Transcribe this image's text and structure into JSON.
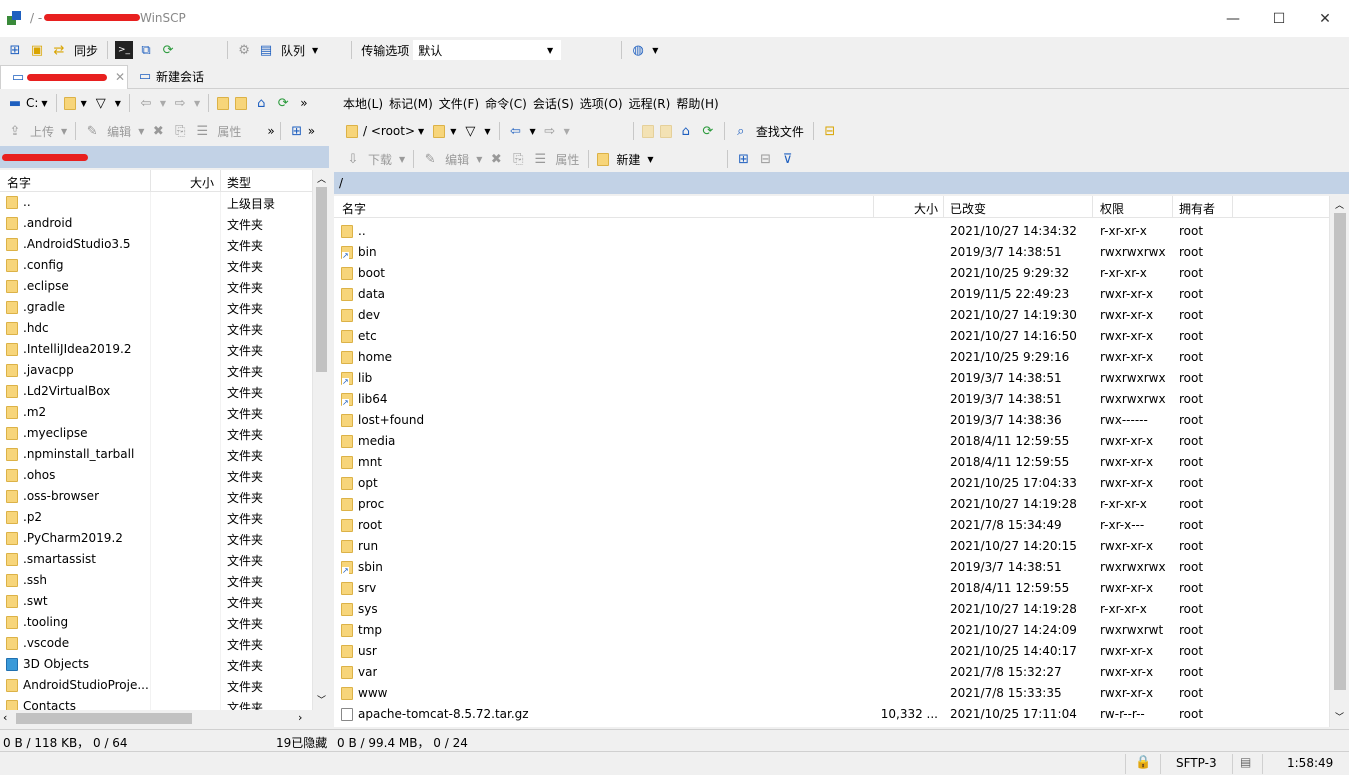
{
  "window": {
    "title": "/ - ▬▬▬▬ - WinSCP",
    "title_visible": "/ -",
    "title_suffix": "WinSCP",
    "minimize": "—",
    "maximize": "☐",
    "close": "✕"
  },
  "toolbar1": {
    "sync_label": "同步",
    "queue_label": "队列",
    "transfer_label": "传输选项",
    "transfer_value": "默认"
  },
  "tabs": {
    "session_tab": "▬▬▬▬",
    "new_session": "新建会话"
  },
  "menu": [
    "本地(L)",
    "标记(M)",
    "文件(F)",
    "命令(C)",
    "会话(S)",
    "选项(O)",
    "远程(R)",
    "帮助(H)"
  ],
  "local": {
    "drive": "C:",
    "upload": "上传",
    "edit": "编辑",
    "properties": "属性",
    "path": "▬▬▬▬",
    "columns": [
      "名字",
      "大小",
      "类型"
    ],
    "rows": [
      {
        "name": "..",
        "type": "上级目录",
        "icon": "up"
      },
      {
        "name": ".android",
        "type": "文件夹",
        "icon": "folder"
      },
      {
        "name": ".AndroidStudio3.5",
        "type": "文件夹",
        "icon": "folder"
      },
      {
        "name": ".config",
        "type": "文件夹",
        "icon": "folder"
      },
      {
        "name": ".eclipse",
        "type": "文件夹",
        "icon": "folder"
      },
      {
        "name": ".gradle",
        "type": "文件夹",
        "icon": "folder"
      },
      {
        "name": ".hdc",
        "type": "文件夹",
        "icon": "folder"
      },
      {
        "name": ".IntelliJIdea2019.2",
        "type": "文件夹",
        "icon": "folder"
      },
      {
        "name": ".javacpp",
        "type": "文件夹",
        "icon": "folder"
      },
      {
        "name": ".Ld2VirtualBox",
        "type": "文件夹",
        "icon": "folder"
      },
      {
        "name": ".m2",
        "type": "文件夹",
        "icon": "folder"
      },
      {
        "name": ".myeclipse",
        "type": "文件夹",
        "icon": "folder"
      },
      {
        "name": ".npminstall_tarball",
        "type": "文件夹",
        "icon": "folder"
      },
      {
        "name": ".ohos",
        "type": "文件夹",
        "icon": "folder"
      },
      {
        "name": ".oss-browser",
        "type": "文件夹",
        "icon": "folder"
      },
      {
        "name": ".p2",
        "type": "文件夹",
        "icon": "folder"
      },
      {
        "name": ".PyCharm2019.2",
        "type": "文件夹",
        "icon": "folder"
      },
      {
        "name": ".smartassist",
        "type": "文件夹",
        "icon": "folder"
      },
      {
        "name": ".ssh",
        "type": "文件夹",
        "icon": "folder"
      },
      {
        "name": ".swt",
        "type": "文件夹",
        "icon": "folder"
      },
      {
        "name": ".tooling",
        "type": "文件夹",
        "icon": "folder"
      },
      {
        "name": ".vscode",
        "type": "文件夹",
        "icon": "folder"
      },
      {
        "name": "3D Objects",
        "type": "文件夹",
        "icon": "obj"
      },
      {
        "name": "AndroidStudioProje...",
        "type": "文件夹",
        "icon": "folder"
      },
      {
        "name": "Contacts",
        "type": "文件夹",
        "icon": "folder"
      }
    ],
    "status_size": "0 B / 118 KB， 0 / 64",
    "status_hidden": "19已隐藏"
  },
  "remote": {
    "path_combo": "/ <root>",
    "find_files": "查找文件",
    "download": "下载",
    "edit": "编辑",
    "properties": "属性",
    "new": "新建",
    "path": "/",
    "columns": [
      "名字",
      "大小",
      "已改变",
      "权限",
      "拥有者"
    ],
    "rows": [
      {
        "name": "..",
        "size": "",
        "changed": "2021/10/27 14:34:32",
        "rights": "r-xr-xr-x",
        "owner": "root",
        "icon": "up"
      },
      {
        "name": "bin",
        "size": "",
        "changed": "2019/3/7 14:38:51",
        "rights": "rwxrwxrwx",
        "owner": "root",
        "icon": "link"
      },
      {
        "name": "boot",
        "size": "",
        "changed": "2021/10/25 9:29:32",
        "rights": "r-xr-xr-x",
        "owner": "root",
        "icon": "folder"
      },
      {
        "name": "data",
        "size": "",
        "changed": "2019/11/5 22:49:23",
        "rights": "rwxr-xr-x",
        "owner": "root",
        "icon": "folder"
      },
      {
        "name": "dev",
        "size": "",
        "changed": "2021/10/27 14:19:30",
        "rights": "rwxr-xr-x",
        "owner": "root",
        "icon": "folder"
      },
      {
        "name": "etc",
        "size": "",
        "changed": "2021/10/27 14:16:50",
        "rights": "rwxr-xr-x",
        "owner": "root",
        "icon": "folder"
      },
      {
        "name": "home",
        "size": "",
        "changed": "2021/10/25 9:29:16",
        "rights": "rwxr-xr-x",
        "owner": "root",
        "icon": "folder"
      },
      {
        "name": "lib",
        "size": "",
        "changed": "2019/3/7 14:38:51",
        "rights": "rwxrwxrwx",
        "owner": "root",
        "icon": "link"
      },
      {
        "name": "lib64",
        "size": "",
        "changed": "2019/3/7 14:38:51",
        "rights": "rwxrwxrwx",
        "owner": "root",
        "icon": "link"
      },
      {
        "name": "lost+found",
        "size": "",
        "changed": "2019/3/7 14:38:36",
        "rights": "rwx------",
        "owner": "root",
        "icon": "folder"
      },
      {
        "name": "media",
        "size": "",
        "changed": "2018/4/11 12:59:55",
        "rights": "rwxr-xr-x",
        "owner": "root",
        "icon": "folder"
      },
      {
        "name": "mnt",
        "size": "",
        "changed": "2018/4/11 12:59:55",
        "rights": "rwxr-xr-x",
        "owner": "root",
        "icon": "folder"
      },
      {
        "name": "opt",
        "size": "",
        "changed": "2021/10/25 17:04:33",
        "rights": "rwxr-xr-x",
        "owner": "root",
        "icon": "folder"
      },
      {
        "name": "proc",
        "size": "",
        "changed": "2021/10/27 14:19:28",
        "rights": "r-xr-xr-x",
        "owner": "root",
        "icon": "folder"
      },
      {
        "name": "root",
        "size": "",
        "changed": "2021/7/8 15:34:49",
        "rights": "r-xr-x---",
        "owner": "root",
        "icon": "folder"
      },
      {
        "name": "run",
        "size": "",
        "changed": "2021/10/27 14:20:15",
        "rights": "rwxr-xr-x",
        "owner": "root",
        "icon": "folder"
      },
      {
        "name": "sbin",
        "size": "",
        "changed": "2019/3/7 14:38:51",
        "rights": "rwxrwxrwx",
        "owner": "root",
        "icon": "link"
      },
      {
        "name": "srv",
        "size": "",
        "changed": "2018/4/11 12:59:55",
        "rights": "rwxr-xr-x",
        "owner": "root",
        "icon": "folder"
      },
      {
        "name": "sys",
        "size": "",
        "changed": "2021/10/27 14:19:28",
        "rights": "r-xr-xr-x",
        "owner": "root",
        "icon": "folder"
      },
      {
        "name": "tmp",
        "size": "",
        "changed": "2021/10/27 14:24:09",
        "rights": "rwxrwxrwt",
        "owner": "root",
        "icon": "folder"
      },
      {
        "name": "usr",
        "size": "",
        "changed": "2021/10/25 14:40:17",
        "rights": "rwxr-xr-x",
        "owner": "root",
        "icon": "folder"
      },
      {
        "name": "var",
        "size": "",
        "changed": "2021/7/8 15:32:27",
        "rights": "rwxr-xr-x",
        "owner": "root",
        "icon": "folder"
      },
      {
        "name": "www",
        "size": "",
        "changed": "2021/7/8 15:33:35",
        "rights": "rwxr-xr-x",
        "owner": "root",
        "icon": "folder"
      },
      {
        "name": "apache-tomcat-8.5.72.tar.gz",
        "size": "10,332 ...",
        "changed": "2021/10/25 17:11:04",
        "rights": "rw-r--r--",
        "owner": "root",
        "icon": "file"
      }
    ],
    "status_size": "0 B / 99.4 MB， 0 / 24"
  },
  "status": {
    "protocol": "SFTP-3",
    "time": "1:58:49"
  },
  "colors": {
    "path_bar": "#c2d2e6",
    "redaction": "#e8201f",
    "folder": "#f7d57a"
  }
}
